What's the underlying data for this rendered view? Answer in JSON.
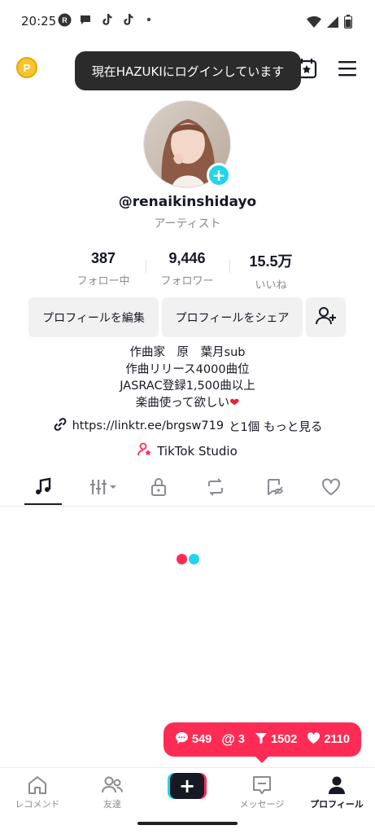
{
  "status_bar": {
    "time": "20:25"
  },
  "header": {
    "coin_label": "P",
    "toast": "現在HAZUKIにログインしています"
  },
  "profile": {
    "username": "@renaikinshidayo",
    "category": "アーティスト",
    "stats": [
      {
        "value": "387",
        "label": "フォロー中"
      },
      {
        "value": "9,446",
        "label": "フォロワー"
      },
      {
        "value": "15.5万",
        "label": "いいね"
      }
    ],
    "buttons": {
      "edit": "プロフィールを編集",
      "share": "プロフィールをシェア"
    },
    "bio_lines": [
      "作曲家　原　葉月sub",
      "作曲リリース4000曲位",
      "JASRAC登録1,500曲以上",
      "楽曲使って欲しい"
    ],
    "bio_heart": "❤",
    "link": "https://linktr.ee/brgsw719",
    "link_suffix": "と1個 もっと見る",
    "studio": "TikTok Studio"
  },
  "tabs": [
    "music-icon",
    "playlist-icon",
    "lock-icon",
    "repost-icon",
    "tagged-icon",
    "heart-icon"
  ],
  "notifications": {
    "comments": "549",
    "mentions": "3",
    "followers": "1502",
    "likes": "2110"
  },
  "bottom_nav": {
    "home": "レコメンド",
    "friends": "友達",
    "create": "+",
    "inbox": "メッセージ",
    "profile": "プロフィール"
  },
  "colors": {
    "accent": "#fe2c55",
    "cyan": "#20d5ec",
    "coin": "#f7c531"
  }
}
